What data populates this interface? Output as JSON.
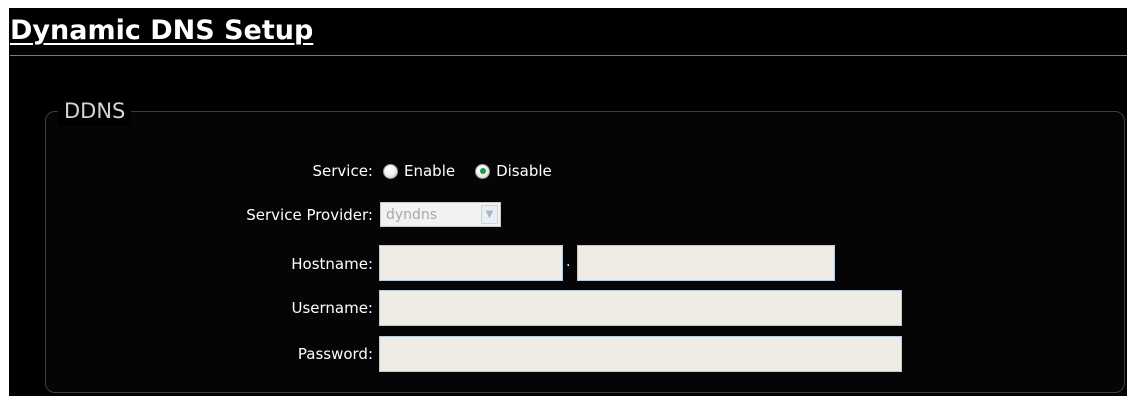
{
  "page": {
    "title": "Dynamic DNS Setup"
  },
  "ddns": {
    "legend": "DDNS",
    "service": {
      "label": "Service:",
      "enable_label": "Enable",
      "disable_label": "Disable",
      "selected": "Disable"
    },
    "service_provider": {
      "label": "Service Provider:",
      "value": "dyndns",
      "disabled": true
    },
    "hostname": {
      "label": "Hostname:",
      "separator": ".",
      "part1": "",
      "part2": ""
    },
    "username": {
      "label": "Username:",
      "value": ""
    },
    "password": {
      "label": "Password:",
      "value": ""
    }
  },
  "colors": {
    "background": "#000000",
    "text": "#ffffff",
    "input_background": "#efece5",
    "input_border": "#b7cbe0",
    "radio_selected": "#1f9a38"
  },
  "icons": {
    "select_arrow": "chevron-down-icon"
  }
}
